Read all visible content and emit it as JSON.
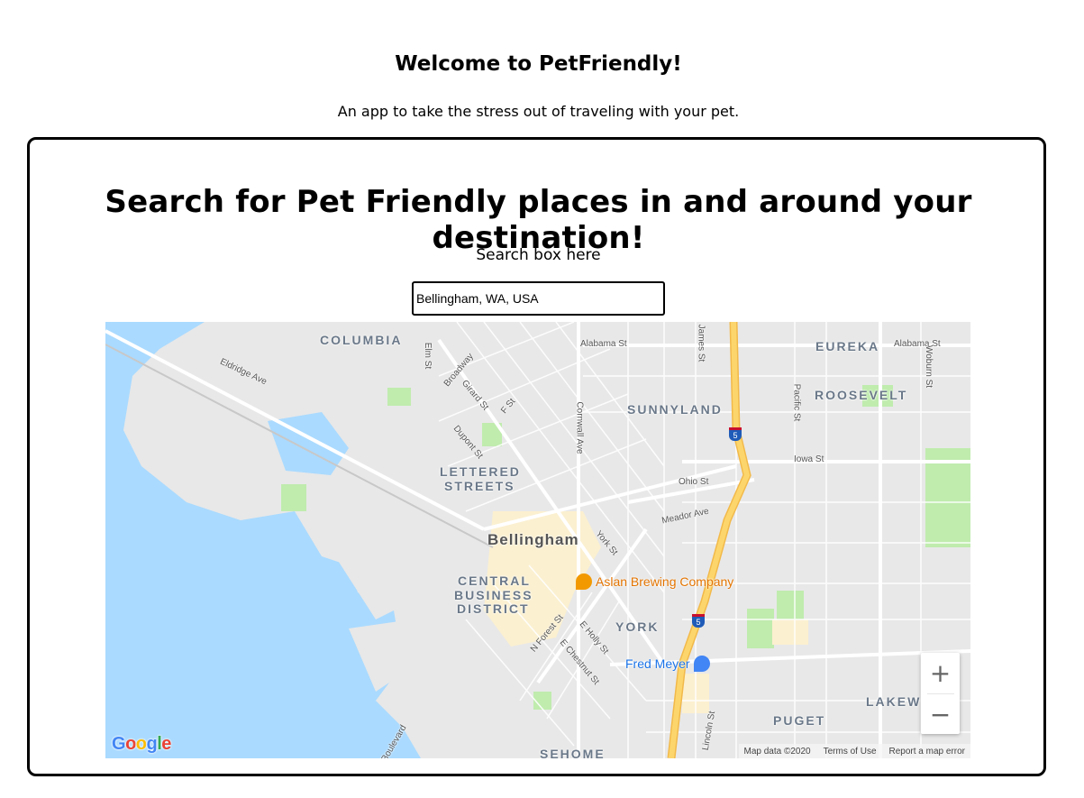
{
  "header": {
    "title": "Welcome to PetFriendly!",
    "tagline": "An app to take the stress out of traveling with your pet."
  },
  "card": {
    "title": "Search for Pet Friendly places in and around your destination!",
    "search_label": "Search box here",
    "search_value": "Bellingham, WA, USA"
  },
  "map": {
    "neighborhoods": [
      "COLUMBIA",
      "EUREKA",
      "SUNNYLAND",
      "ROOSEVELT",
      "LETTERED",
      "STREETS",
      "CENTRAL",
      "BUSINESS",
      "DISTRICT",
      "YORK",
      "PUGET",
      "LAKEW",
      "SEHOME"
    ],
    "city": "Bellingham",
    "streets": [
      "Alabama St",
      "Alabama St",
      "Eldridge Ave",
      "Elm St",
      "Broadway",
      "Girard St",
      "F St",
      "Dupont St",
      "Cornwall Ave",
      "James St",
      "Pacific St",
      "Woburn St",
      "Iowa St",
      "Ohio St",
      "Meador Ave",
      "York St",
      "N Forest St",
      "E Holly St",
      "E Chestnut St",
      "Lincoln St",
      "Boulevard"
    ],
    "pois": [
      {
        "name": "Aslan Brewing Company",
        "color": "#e37400"
      },
      {
        "name": "Fred Meyer",
        "color": "#1a73e8"
      }
    ],
    "interstate": "5",
    "zoom_in": "+",
    "zoom_out": "−",
    "logo": "Google",
    "attribution": {
      "data": "Map data ©2020",
      "terms": "Terms of Use",
      "report": "Report a map error"
    },
    "colors": {
      "water": "#aadaff",
      "land": "#e8e8e8",
      "park": "#c0ecae",
      "highway": "#fcd66c",
      "downtown": "#fbf0d0"
    }
  }
}
